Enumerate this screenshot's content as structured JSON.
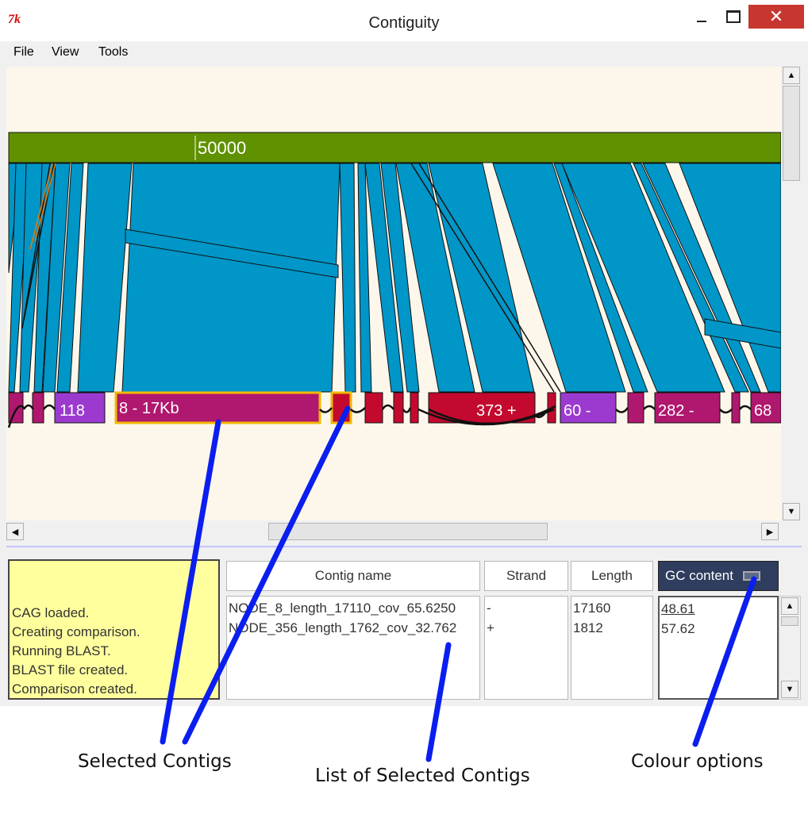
{
  "window": {
    "app_logo": "7k",
    "title": "Contiguity",
    "minimize_icon": "minimize-icon",
    "maximize_icon": "maximize-icon",
    "close_glyph": "✕"
  },
  "menu": [
    "File",
    "View",
    "Tools"
  ],
  "canvas": {
    "reference_tick_label": "50000",
    "colors": {
      "background": "#fcf7ea",
      "reference_bar": "#5f9100",
      "blast_hits": "#0096c8",
      "contig_magenta": "#b0176e",
      "contig_red": "#c30a2e",
      "contig_purple": "#9c3ad0",
      "selected_outline": "#f2b800"
    },
    "contig_labels": [
      "118",
      "8 - 17Kb",
      "373 +",
      "60 -",
      "282 -",
      "68"
    ]
  },
  "status": {
    "lines": [
      "CAG loaded.",
      "Creating comparison.",
      "Running BLAST.",
      "BLAST file created.",
      "Comparison created."
    ],
    "background": "#ffff9e"
  },
  "table": {
    "headers": {
      "name": "Contig name",
      "strand": "Strand",
      "length": "Length",
      "gc": "GC content"
    },
    "names": [
      "NODE_8_length_17110_cov_65.6250",
      "NODE_356_length_1762_cov_32.762"
    ],
    "strands": [
      "-",
      "+"
    ],
    "lengths": [
      "17160",
      "1812"
    ],
    "gc": [
      "48.61",
      "57.62"
    ]
  },
  "annotations": {
    "selected": "Selected Contigs",
    "list": "List of Selected Contigs",
    "colour": "Colour options",
    "color": "#0a1ef0"
  }
}
